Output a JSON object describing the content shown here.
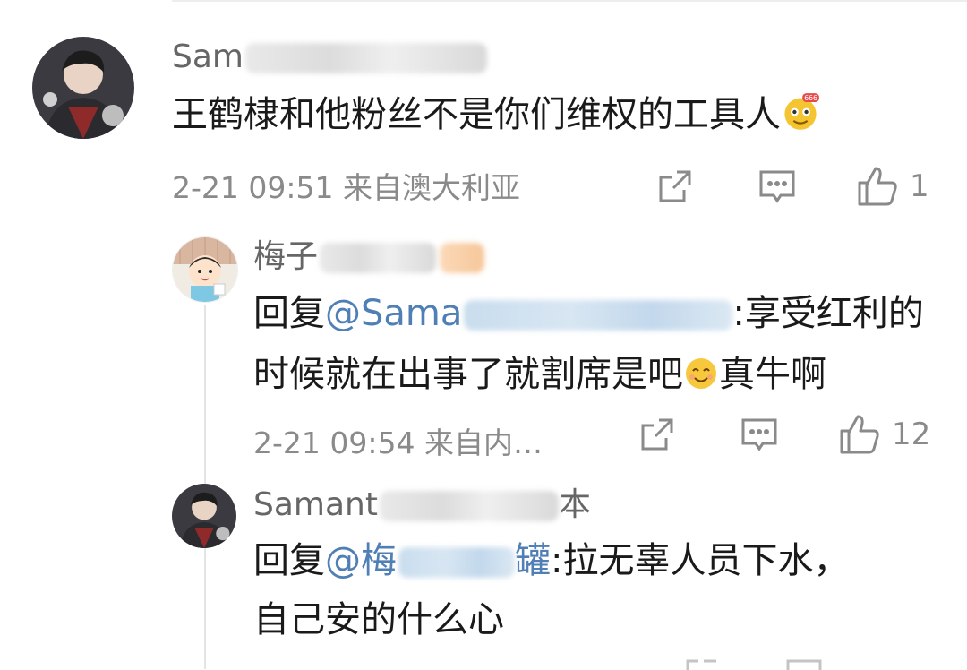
{
  "comments": [
    {
      "username_visible": "Sam",
      "text": "王鹤棣和他粉丝不是你们维权的工具人",
      "emoji": "666-face",
      "date": "2-21",
      "time": "09:51",
      "location": "来自澳大利亚",
      "likes": "1",
      "replies": [
        {
          "username_visible": "梅子",
          "reply_prefix": "回复",
          "mention_visible": "@Sama",
          "text_line1": ":享受红利的",
          "text_line2": "时候就在出事了就割席是吧",
          "text_line3": "真牛啊",
          "emoji": "smile-face",
          "date": "2-21",
          "time": "09:54",
          "location": "来自内…",
          "likes": "12"
        },
        {
          "username_visible": "Samant",
          "username_suffix": "本",
          "reply_prefix": "回复",
          "mention_visible": "@梅",
          "mention_suffix": "罐",
          "text_line1": ":拉无辜人员下水，",
          "text_line2": "自己安的什么心"
        }
      ]
    }
  ],
  "icons": {
    "share": "share-icon",
    "comment": "comment-icon",
    "like": "like-icon"
  },
  "colors": {
    "mention": "#4f7fb5",
    "meta": "#8a8a8a",
    "username": "#666666"
  }
}
